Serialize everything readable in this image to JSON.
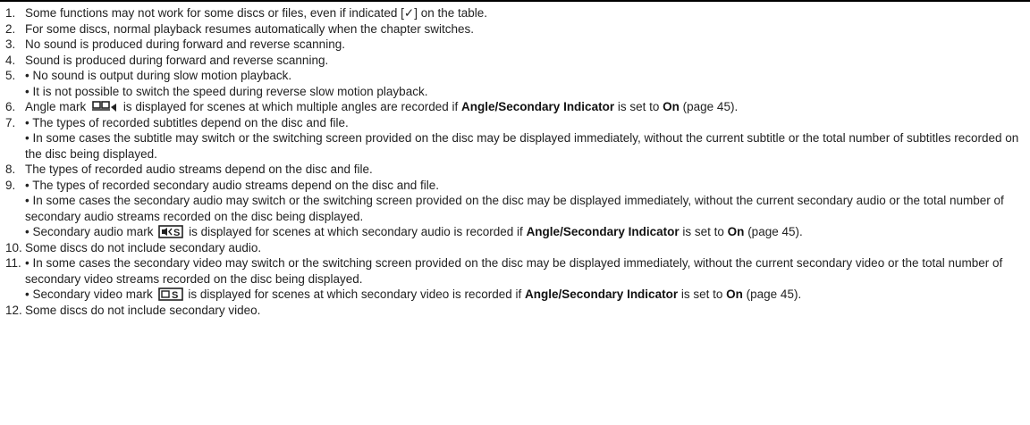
{
  "notes": [
    {
      "num": "1.",
      "lines": [
        "Some functions may not work for some discs or files, even if indicated [✓] on the table."
      ]
    },
    {
      "num": "2.",
      "lines": [
        "For some discs, normal playback resumes automatically when the chapter switches."
      ]
    },
    {
      "num": "3.",
      "lines": [
        "No sound is produced during forward and reverse scanning."
      ]
    },
    {
      "num": "4.",
      "lines": [
        "Sound is produced during forward and reverse scanning."
      ]
    },
    {
      "num": "5.",
      "lines": [
        "• No sound is output during slow motion playback.",
        "• It is not possible to switch the speed during reverse slow motion playback."
      ]
    },
    {
      "num": "6.",
      "pre": "Angle mark",
      "post": "is displayed for scenes at which multiple angles are recorded if",
      "bold1": "Angle/Secondary Indicator",
      "mid": "is set to",
      "bold2": "On",
      "tail": "(page 45).",
      "icon": "angle-mark-icon"
    },
    {
      "num": "7.",
      "lines": [
        "• The types of recorded subtitles depend on the disc and file.",
        "• In some cases the subtitle may switch or the switching screen provided on the disc may be displayed immediately, without the current subtitle or the total number of subtitles recorded on the disc being displayed."
      ]
    },
    {
      "num": "8.",
      "lines": [
        "The types of recorded audio streams depend on the disc and file."
      ]
    },
    {
      "num": "9.",
      "lines": [
        "• The types of recorded secondary audio streams depend on the disc and file.",
        "• In some cases the secondary audio may switch or the switching screen provided on the disc may be displayed immediately, without the current secondary audio or the total number of secondary audio streams recorded on the disc being displayed."
      ],
      "mark": {
        "pre": "• Secondary audio mark",
        "post": "is displayed for scenes at which secondary audio is recorded if",
        "bold1": "Angle/Secondary Indicator",
        "mid": "is set to",
        "bold2": "On",
        "tail": "(page 45).",
        "icon": "secondary-audio-mark-icon"
      }
    },
    {
      "num": "10.",
      "lines": [
        "Some discs do not include secondary audio."
      ]
    },
    {
      "num": "11.",
      "lines": [
        "• In some cases the secondary video may switch or the switching screen provided on the disc may be displayed immediately, without the current secondary video or the total number of secondary video streams recorded on the disc being displayed."
      ],
      "mark": {
        "pre": "• Secondary video mark",
        "post": "is displayed for scenes at which secondary video is recorded if",
        "bold1": "Angle/Secondary Indicator",
        "mid": "is set to",
        "bold2": "On",
        "tail": "(page 45).",
        "icon": "secondary-video-mark-icon"
      }
    },
    {
      "num": "12.",
      "lines": [
        "Some discs do not include secondary video."
      ]
    }
  ]
}
